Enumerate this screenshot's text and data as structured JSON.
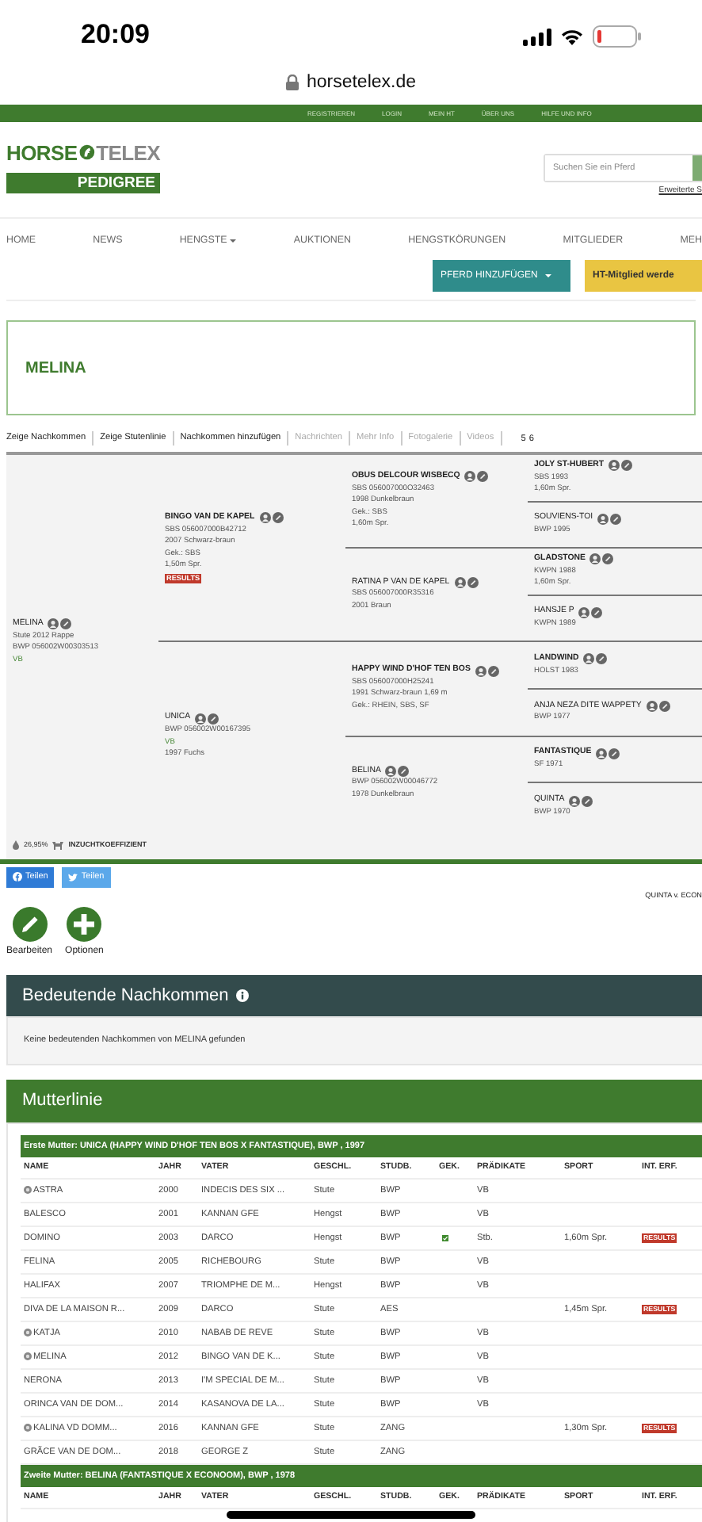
{
  "status_bar": {
    "time": "20:09"
  },
  "browser": {
    "url": "horsetelex.de"
  },
  "top_menu": [
    "REGISTRIEREN",
    "LOGIN",
    "MEIN HT",
    "ÜBER UNS",
    "HILFE UND INFO"
  ],
  "logo": {
    "word_1": "HORSE",
    "word_2": "TELEX",
    "subtitle": "PEDIGREE"
  },
  "search": {
    "placeholder": "Suchen Sie ein Pferd",
    "advanced_link": "Erweiterte S"
  },
  "nav": [
    {
      "label": "HOME",
      "dropdown": false
    },
    {
      "label": "NEWS",
      "dropdown": false
    },
    {
      "label": "HENGSTE",
      "dropdown": true
    },
    {
      "label": "AUKTIONEN",
      "dropdown": false
    },
    {
      "label": "HENGSTKÖRUNGEN",
      "dropdown": false
    },
    {
      "label": "MITGLIEDER",
      "dropdown": false
    },
    {
      "label": "MEH",
      "dropdown": false
    }
  ],
  "actions": [
    {
      "label": "PFERD HINZUFÜGEN",
      "kind": "dropdown"
    },
    {
      "label": "HT-Mitglied werde",
      "kind": "highlight"
    }
  ],
  "horse": {
    "name": "MELINA"
  },
  "tabs": [
    {
      "label": "Zeige Nachkommen",
      "disabled": false
    },
    {
      "label": "Zeige Stutenlinie",
      "disabled": false
    },
    {
      "label": "Nachkommen hinzufügen",
      "disabled": false
    },
    {
      "label": "Nachrichten",
      "disabled": true
    },
    {
      "label": "Mehr Info",
      "disabled": true
    },
    {
      "label": "Fotogalerie",
      "disabled": true
    },
    {
      "label": "Videos",
      "disabled": true
    }
  ],
  "pages": [
    "5",
    "6"
  ],
  "pedigree": {
    "name": "MELINA",
    "kind": "mare",
    "lines": [
      {
        "text": "Stute 2012 Rappe",
        "kind": "plain"
      },
      {
        "text": "BWP 056002W00303513",
        "kind": "plain"
      },
      {
        "text": "VB",
        "kind": "predicate"
      }
    ],
    "parents": [
      {
        "name": "BINGO VAN DE KAPEL",
        "kind": "stallion",
        "lines": [
          {
            "text": "SBS 056007000B42712",
            "kind": "plain"
          },
          {
            "text": "2007 Schwarz-braun",
            "kind": "plain"
          },
          {
            "text": "Gek.: SBS",
            "kind": "plain"
          },
          {
            "text": "1,50m Spr.",
            "kind": "plain"
          }
        ],
        "results": "RESULTS",
        "parents": [
          {
            "name": "OBUS DELCOUR WISBECQ",
            "kind": "stallion",
            "lines": [
              {
                "text": "SBS 056007000O32463",
                "kind": "plain"
              },
              {
                "text": "1998 Dunkelbraun",
                "kind": "plain"
              },
              {
                "text": "Gek.: SBS",
                "kind": "plain"
              },
              {
                "text": "1,60m Spr.",
                "kind": "plain"
              }
            ],
            "parents": [
              {
                "name": "JOLY ST-HUBERT",
                "kind": "stallion",
                "lines": [
                  {
                    "text": "SBS 1993",
                    "kind": "plain"
                  },
                  {
                    "text": "1,60m Spr.",
                    "kind": "plain"
                  }
                ]
              },
              {
                "name": "SOUVIENS-TOI",
                "kind": "mare",
                "lines": [
                  {
                    "text": "BWP 1995",
                    "kind": "plain"
                  }
                ]
              }
            ]
          },
          {
            "name": "RATINA P VAN DE KAPEL",
            "kind": "mare",
            "lines": [
              {
                "text": "SBS 056007000R35316",
                "kind": "plain"
              },
              {
                "text": "2001 Braun",
                "kind": "plain"
              }
            ],
            "parents": [
              {
                "name": "GLADSTONE",
                "kind": "stallion",
                "lines": [
                  {
                    "text": "KWPN 1988",
                    "kind": "plain"
                  },
                  {
                    "text": "1,60m Spr.",
                    "kind": "plain"
                  }
                ]
              },
              {
                "name": "HANSJE P",
                "kind": "mare",
                "lines": [
                  {
                    "text": "KWPN 1989",
                    "kind": "plain"
                  }
                ]
              }
            ]
          }
        ]
      },
      {
        "name": "UNICA",
        "kind": "mare",
        "lines": [
          {
            "text": "BWP 056002W00167395",
            "kind": "plain"
          },
          {
            "text": "VB",
            "kind": "predicate"
          },
          {
            "text": "1997 Fuchs",
            "kind": "plain"
          }
        ],
        "parents": [
          {
            "name": "HAPPY WIND D'HOF TEN BOS",
            "kind": "stallion",
            "lines": [
              {
                "text": "SBS 056007000H25241",
                "kind": "plain"
              },
              {
                "text": "1991 Schwarz-braun 1,69 m",
                "kind": "plain"
              },
              {
                "text": "Gek.: RHEIN, SBS, SF",
                "kind": "plain"
              }
            ],
            "parents": [
              {
                "name": "LANDWIND",
                "kind": "stallion",
                "lines": [
                  {
                    "text": "HOLST 1983",
                    "kind": "plain"
                  }
                ]
              },
              {
                "name": "ANJA NEZA DITE WAPPETY",
                "kind": "mare",
                "lines": [
                  {
                    "text": "BWP 1977",
                    "kind": "plain"
                  }
                ]
              }
            ]
          },
          {
            "name": "BELINA",
            "kind": "mare",
            "lines": [
              {
                "text": "BWP 056002W00046772",
                "kind": "plain"
              },
              {
                "text": "1978 Dunkelbraun",
                "kind": "plain"
              }
            ],
            "parents": [
              {
                "name": "FANTASTIQUE",
                "kind": "stallion",
                "lines": [
                  {
                    "text": "SF 1971",
                    "kind": "plain"
                  }
                ]
              },
              {
                "name": "QUINTA",
                "kind": "mare",
                "lines": [
                  {
                    "text": "BWP 1970",
                    "kind": "plain"
                  }
                ]
              }
            ]
          }
        ]
      }
    ]
  },
  "inbreeding": {
    "value": "26,95%",
    "label": "INZUCHTKOEFFIZIENT"
  },
  "share": [
    {
      "label": "Teilen",
      "kind": "facebook"
    },
    {
      "label": "Teilen",
      "kind": "twitter"
    }
  ],
  "ancestry_note": "QUINTA v. ECON",
  "tools": [
    {
      "label": "Bearbeiten",
      "kind": "edit"
    },
    {
      "label": "Optionen",
      "kind": "add"
    }
  ],
  "notable_offspring": {
    "title": "Bedeutende Nachkommen",
    "message": "Keine bedeutenden Nachkommen von MELINA gefunden"
  },
  "dam_line": {
    "title": "Mutterlinie",
    "groups": [
      {
        "title": "Erste Mutter: UNICA (HAPPY WIND D'HOF TEN BOS X FANTASTIQUE), BWP , 1997",
        "columns": [
          "NAME",
          "JAHR",
          "VATER",
          "GESCHL.",
          "STUDB.",
          "GEK.",
          "PRÄDIKATE",
          "SPORT",
          "INT. ERF."
        ],
        "rows": [
          {
            "name": "ASTRA",
            "marked": true,
            "year": "2000",
            "sire": "INDECIS DES SIX ...",
            "sex": "Stute",
            "studbook": "BWP",
            "approved": false,
            "predicate": "VB"
          },
          {
            "name": "BALESCO",
            "marked": false,
            "year": "2001",
            "sire": "KANNAN GFE",
            "sex": "Hengst",
            "studbook": "BWP",
            "approved": false,
            "predicate": "VB"
          },
          {
            "name": "DOMINO",
            "marked": false,
            "year": "2003",
            "sire": "DARCO",
            "sex": "Hengst",
            "studbook": "BWP",
            "approved": true,
            "predicate": "Stb.",
            "sport": "1,60m Spr.",
            "results": "RESULTS"
          },
          {
            "name": "FELINA",
            "marked": false,
            "year": "2005",
            "sire": "RICHEBOURG",
            "sex": "Stute",
            "studbook": "BWP",
            "approved": false,
            "predicate": "VB"
          },
          {
            "name": "HALIFAX",
            "marked": false,
            "year": "2007",
            "sire": "TRIOMPHE DE M...",
            "sex": "Hengst",
            "studbook": "BWP",
            "approved": false,
            "predicate": "VB"
          },
          {
            "name": "DIVA DE LA MAISON R...",
            "marked": false,
            "year": "2009",
            "sire": "DARCO",
            "sex": "Stute",
            "studbook": "AES",
            "approved": false,
            "sport": "1,45m Spr.",
            "results": "RESULTS"
          },
          {
            "name": "KATJA",
            "marked": true,
            "year": "2010",
            "sire": "NABAB DE REVE",
            "sex": "Stute",
            "studbook": "BWP",
            "approved": false,
            "predicate": "VB"
          },
          {
            "name": "MELINA",
            "marked": true,
            "year": "2012",
            "sire": "BINGO VAN DE K...",
            "sex": "Stute",
            "studbook": "BWP",
            "approved": false,
            "predicate": "VB"
          },
          {
            "name": "NERONA",
            "marked": false,
            "year": "2013",
            "sire": "I'M SPECIAL DE M...",
            "sex": "Stute",
            "studbook": "BWP",
            "approved": false,
            "predicate": "VB"
          },
          {
            "name": "ORINCA VAN DE DOM...",
            "marked": false,
            "year": "2014",
            "sire": "KASANOVA DE LA...",
            "sex": "Stute",
            "studbook": "BWP",
            "approved": false,
            "predicate": "VB"
          },
          {
            "name": "KALINA VD DOMM...",
            "marked": true,
            "year": "2016",
            "sire": "KANNAN GFE",
            "sex": "Stute",
            "studbook": "ZANG",
            "approved": false,
            "sport": "1,30m Spr.",
            "results": "RESULTS"
          },
          {
            "name": "GRÃCE VAN DE DOM...",
            "marked": false,
            "year": "2018",
            "sire": "GEORGE Z",
            "sex": "Stute",
            "studbook": "ZANG",
            "approved": false
          }
        ]
      },
      {
        "title": "Zweite Mutter: BELINA (FANTASTIQUE X ECONOOM), BWP , 1978",
        "columns": [
          "NAME",
          "JAHR",
          "VATER",
          "GESCHL.",
          "STUDB.",
          "GEK.",
          "PRÄDIKATE",
          "SPORT",
          "INT. ERF."
        ]
      }
    ]
  }
}
